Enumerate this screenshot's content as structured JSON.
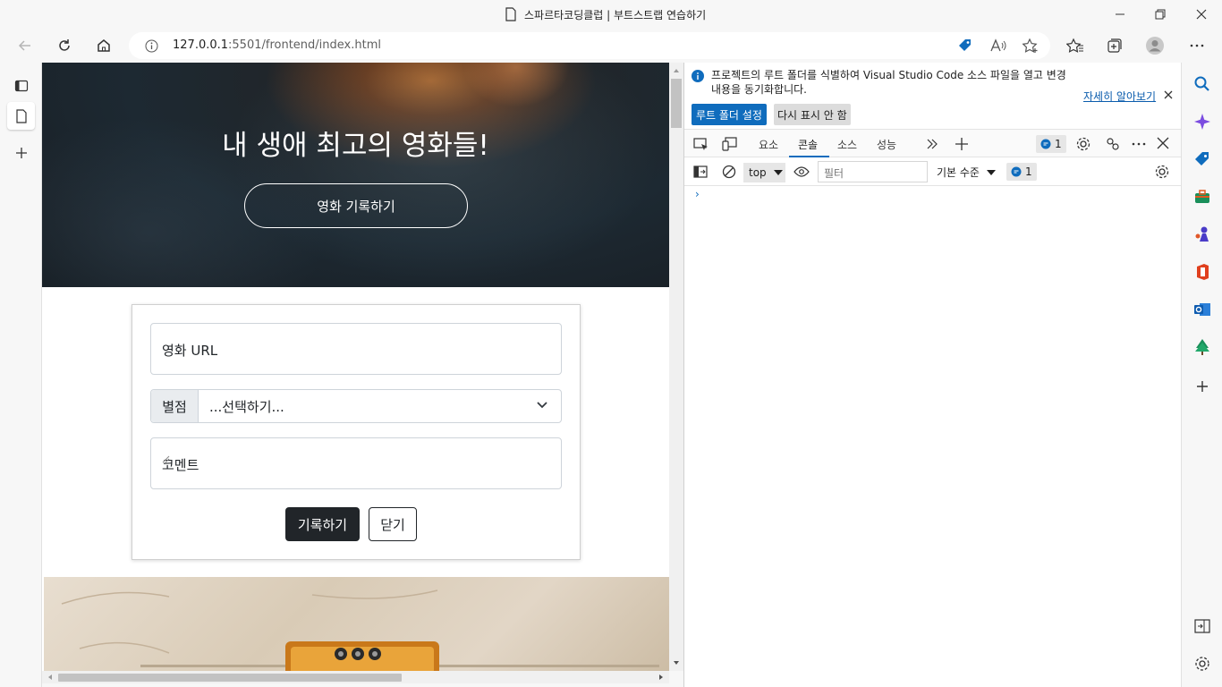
{
  "window": {
    "title": "스파르타코딩클럽 | 부트스트랩 연습하기"
  },
  "address_bar": {
    "url_host": "127.0.0.1",
    "url_rest": ":5501/frontend/index.html"
  },
  "hero": {
    "title": "내 생애 최고의 영화들!",
    "button_label": "영화 기록하기"
  },
  "form": {
    "url_placeholder": "영화 URL",
    "star_label": "별점",
    "star_selected": "...선택하기...",
    "comment_placeholder": "코멘트",
    "save_label": "기록하기",
    "close_label": "닫기"
  },
  "devtools": {
    "info_text": "프로젝트의 루트 폴더를 식별하여 Visual Studio Code 소스 파일을 열고 변경 내용을 동기화합니다.",
    "learn_more": "자세히 알아보기",
    "set_root_button": "루트 폴더 설정",
    "dont_show_button": "다시 표시 안 함",
    "tabs": [
      "요소",
      "콘솔",
      "소스",
      "성능"
    ],
    "active_tab": "콘솔",
    "message_count": "1",
    "context": "top",
    "filter_placeholder": "필터",
    "level": "기본 수준",
    "issue_count": "1",
    "prompt": "›"
  },
  "colors": {
    "accent": "#0f6cbd",
    "hero_dark": "#1d2932",
    "button_dark": "#212529"
  }
}
